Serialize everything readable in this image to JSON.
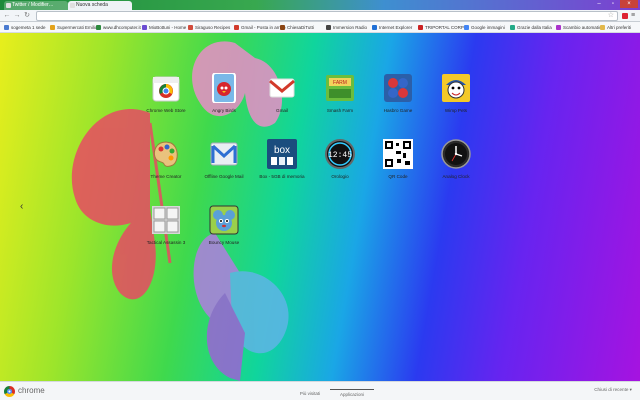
{
  "window": {
    "tabs": [
      {
        "label": "Twitter / Modifier…"
      },
      {
        "label": "Nuova scheda"
      }
    ]
  },
  "toolbar": {
    "address": ""
  },
  "bookmarks": [
    {
      "label": "sogemeta 1 sede",
      "color": "#4a7bd0"
    },
    {
      "label": "Supermercati Emilio",
      "color": "#e3a21a"
    },
    {
      "label": "www.dhcomputer.it",
      "color": "#2b8a3e"
    },
    {
      "label": "MioBottuni - Home",
      "color": "#6a4bd2"
    },
    {
      "label": "Siraguso Recipes",
      "color": "#d24b3b"
    },
    {
      "label": "Gmail - Posta in arrivo",
      "color": "#d23a2b"
    },
    {
      "label": "ChiesaDiTutti",
      "color": "#8b4513"
    },
    {
      "label": "Immersion Radio",
      "color": "#444"
    },
    {
      "label": "Internet Explorer",
      "color": "#1e6fd6"
    },
    {
      "label": "TRIPORTAL CORP",
      "color": "#c22"
    },
    {
      "label": "Google immagini",
      "color": "#4285f4"
    },
    {
      "label": "Grazie dalla Italia",
      "color": "#2a8"
    },
    {
      "label": "Scambio automatico",
      "color": "#a3c"
    },
    {
      "label": "Altri preferiti",
      "color": "#e2b84a"
    }
  ],
  "apps": [
    {
      "label": "Chrome Web Store",
      "icon": "webstore-icon"
    },
    {
      "label": "Angry Birds",
      "icon": "angry-birds-icon"
    },
    {
      "label": "Gmail",
      "icon": "gmail-icon"
    },
    {
      "label": "Smash Farm",
      "icon": "farm-icon"
    },
    {
      "label": "Hasbro Game",
      "icon": "game-buttons-icon"
    },
    {
      "label": "Wimp Pets",
      "icon": "cartoon-face-icon"
    },
    {
      "label": "Theme Creator",
      "icon": "palette-icon"
    },
    {
      "label": "Offline Google Mail",
      "icon": "offline-gmail-icon"
    },
    {
      "label": "Box - 5GB di memoria",
      "icon": "box-icon"
    },
    {
      "label": "Orologio",
      "icon": "digital-clock-icon"
    },
    {
      "label": "QR Code",
      "icon": "qr-code-icon"
    },
    {
      "label": "Analog Clock",
      "icon": "analog-clock-icon"
    },
    {
      "label": "Tactical Assassin 3",
      "icon": "grid-icon"
    },
    {
      "label": "Bouncy Mouse",
      "icon": "mouse-icon"
    }
  ],
  "footer": {
    "brand": "chrome",
    "pages": [
      {
        "label": "Più visitati"
      },
      {
        "label": "Applicazioni"
      }
    ],
    "closed_tabs": "Chiusi di recente ▾"
  },
  "colors": {
    "gradient": [
      "#e8ee1c",
      "#3fd94d",
      "#1aa6e6",
      "#2b3af0",
      "#a613e0"
    ],
    "accent": "#d23a2b"
  }
}
